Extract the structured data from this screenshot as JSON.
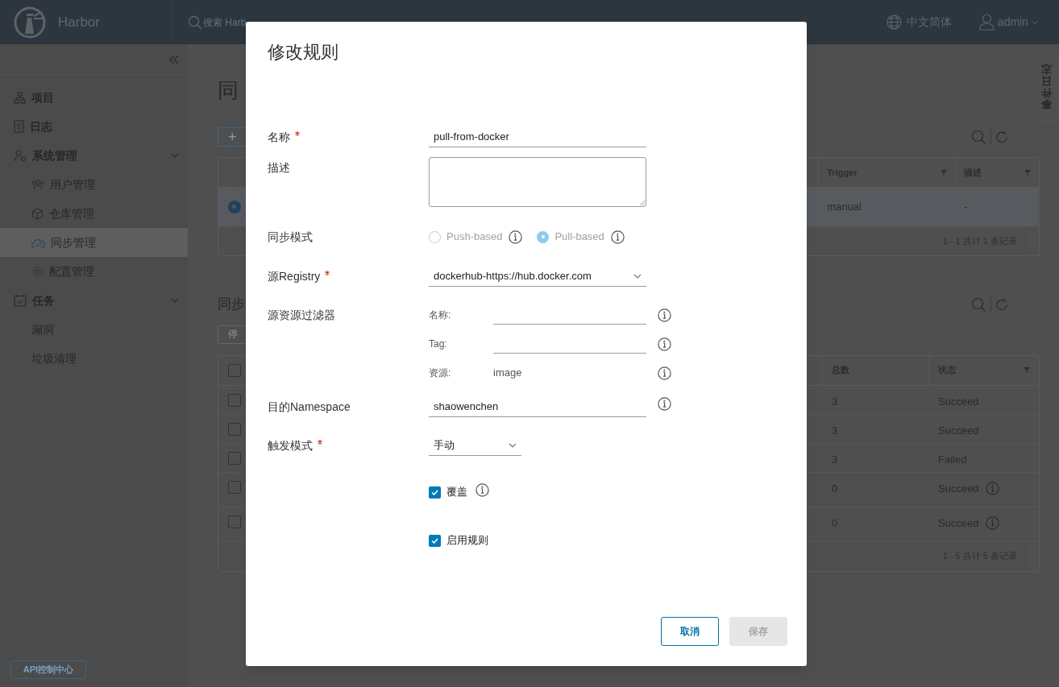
{
  "header": {
    "logo_text": "Harbor",
    "search_placeholder": "搜索 Harb",
    "language": "中文简体",
    "user": "admin"
  },
  "sidebar": {
    "items": [
      {
        "label": "项目",
        "selected": false
      },
      {
        "label": "日志",
        "selected": false
      },
      {
        "label": "系统管理",
        "selected": false,
        "expanded": true,
        "children": [
          {
            "label": "用户管理",
            "selected": false
          },
          {
            "label": "仓库管理",
            "selected": false
          },
          {
            "label": "同步管理",
            "selected": true
          },
          {
            "label": "配置管理",
            "selected": false
          }
        ]
      },
      {
        "label": "任务",
        "selected": false,
        "expanded": true,
        "children": [
          {
            "label": "漏洞",
            "selected": false
          },
          {
            "label": "垃圾清理",
            "selected": false
          }
        ]
      }
    ],
    "api_button": "API控制中心"
  },
  "event_log_tab": "事件日志",
  "page": {
    "title": "同",
    "add_button": "+",
    "policies": {
      "columns": [
        "Trigger",
        "描述"
      ],
      "rows": [
        {
          "selected": true,
          "cells": [
            "manual",
            "-"
          ]
        }
      ],
      "footer": "1 - 1 共计 1 条记录"
    },
    "executions_title": "同步",
    "stop_button": "停",
    "select_all_checked": false,
    "executions": {
      "columns": [
        "总数",
        "状态"
      ],
      "rows": [
        {
          "checked": false,
          "total": "3",
          "status": "Succeed",
          "info": false
        },
        {
          "checked": false,
          "total": "3",
          "status": "Succeed",
          "info": false
        },
        {
          "checked": false,
          "total": "3",
          "status": "Failed",
          "info": false
        },
        {
          "checked": false,
          "total": "0",
          "status": "Succeed",
          "info": true
        },
        {
          "checked": false,
          "total": "0",
          "status": "Succeed",
          "info": true
        }
      ],
      "footer": "1 - 5 共计 5 条记录"
    }
  },
  "dialog": {
    "title": "修改规则",
    "name": {
      "label": "名称",
      "required": true,
      "value": "pull-from-docker"
    },
    "description": {
      "label": "描述",
      "required": false
    },
    "mode": {
      "label": "同步模式",
      "required": false,
      "options": [
        {
          "label": "Push-based",
          "selected": false
        },
        {
          "label": "Pull-based",
          "selected": true
        }
      ]
    },
    "source_registry": {
      "label": "源Registry",
      "required": true,
      "value": "dockerhub-https://hub.docker.com"
    },
    "filter": {
      "label": "源资源过滤器",
      "items": [
        {
          "label": "名称:",
          "kind": "input"
        },
        {
          "label": "Tag:",
          "kind": "input"
        },
        {
          "label": "资源:",
          "kind": "text",
          "value": "image"
        }
      ]
    },
    "destination": {
      "label": "目的Namespace",
      "required": false,
      "value": "shaowenchen"
    },
    "trigger": {
      "label": "触发模式",
      "required": true,
      "value": "手动"
    },
    "options": [
      {
        "label": "覆盖",
        "checked": true,
        "info": true
      },
      {
        "label": "启用规则",
        "checked": true,
        "info": false
      }
    ],
    "buttons": [
      {
        "label": "取消",
        "kind": "secondary",
        "disabled": false
      },
      {
        "label": "保存",
        "kind": "primary",
        "disabled": true
      }
    ]
  }
}
